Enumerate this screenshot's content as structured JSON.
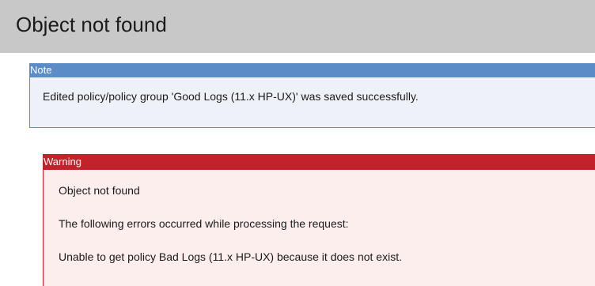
{
  "title": "Object not found",
  "note": {
    "label": "Note",
    "message": "Edited policy/policy group 'Good Logs (11.x HP-UX)' was saved successfully."
  },
  "warning": {
    "label": "Warning",
    "lines": [
      "Object not found",
      "The following errors occurred while processing the request:",
      "Unable to get policy Bad Logs (11.x HP-UX) because it does not exist."
    ]
  },
  "colors": {
    "title_bar": "#c8c8c8",
    "note_accent": "#5b8cc8",
    "note_background": "#eef2f8",
    "warning_accent": "#c4222a",
    "warning_background": "#fdeeee"
  }
}
